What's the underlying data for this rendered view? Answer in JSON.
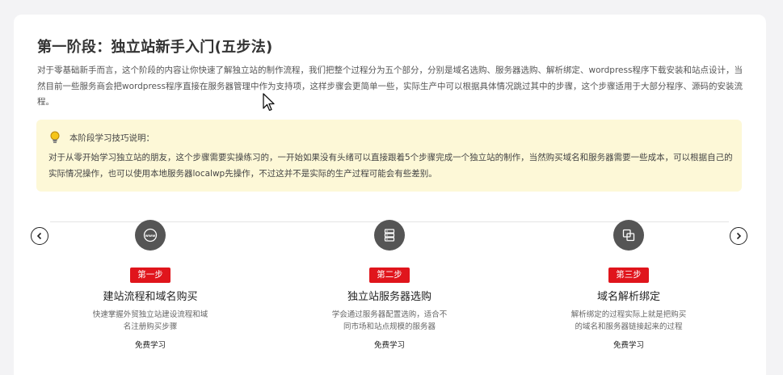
{
  "section": {
    "title": "第一阶段：独立站新手入门(五步法)",
    "intro": "对于零基础新手而言，这个阶段的内容让你快速了解独立站的制作流程，我们把整个过程分为五个部分，分别是域名选购、服务器选购、解析绑定、wordpress程序下载安装和站点设计，当然目前一些服务商会把wordpress程序直接在服务器管理中作为支持项，这样步骤会更简单一些，实际生产中可以根据具体情况跳过其中的步骤，这个步骤适用于大部分程序、源码的安装流程。"
  },
  "tip": {
    "icon": "lightbulb-icon",
    "heading": "本阶段学习技巧说明：",
    "text": "对于从零开始学习独立站的朋友，这个步骤需要实操练习的，一开始如果没有头绪可以直接跟着5个步骤完成一个独立站的制作，当然购买域名和服务器需要一些成本，可以根据自己的实际情况操作，也可以使用本地服务器localwp先操作，不过这并不是实际的生产过程可能会有些差别。"
  },
  "carousel": {
    "prev_icon": "chevron-left-icon",
    "next_icon": "chevron-right-icon",
    "steps": [
      {
        "icon": "www-icon",
        "badge": "第一步",
        "title": "建站流程和域名购买",
        "desc": "快速掌握外贸独立站建设流程和域名注册购买步骤",
        "link": "免费学习"
      },
      {
        "icon": "server-icon",
        "badge": "第二步",
        "title": "独立站服务器选购",
        "desc": "学会通过服务器配置选购，适合不同市场和站点规模的服务器",
        "link": "免费学习"
      },
      {
        "icon": "link-icon",
        "badge": "第三步",
        "title": "域名解析绑定",
        "desc": "解析绑定的过程实际上就是把购买的域名和服务器链接起来的过程",
        "link": "免费学习"
      }
    ]
  },
  "colors": {
    "badge": "#e0151c",
    "tip_bg": "#fdf8d7",
    "icon_bg": "#555555"
  }
}
